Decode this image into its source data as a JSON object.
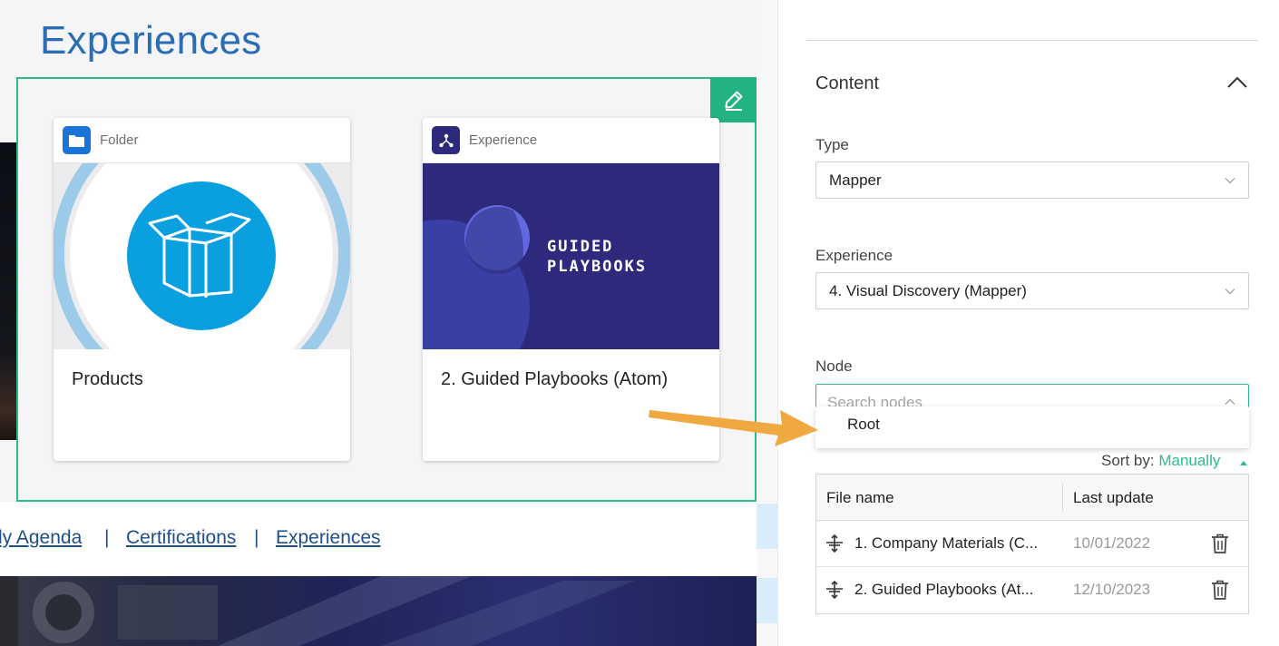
{
  "page": {
    "title": "Experiences"
  },
  "cards": [
    {
      "type_label": "Folder",
      "title": "Products"
    },
    {
      "type_label": "Experience",
      "title": "2. Guided Playbooks (Atom)",
      "image_text_line1": "GUIDED",
      "image_text_line2": "PLAYBOOKS"
    }
  ],
  "footer_links": {
    "link1": "ly Agenda",
    "separator": "|",
    "link2": "Certifications",
    "link3": "Experiences"
  },
  "panel": {
    "section_title": "Content",
    "type": {
      "label": "Type",
      "value": "Mapper"
    },
    "experience": {
      "label": "Experience",
      "value": "4. Visual Discovery (Mapper)"
    },
    "node": {
      "label": "Node",
      "placeholder": "Search nodes",
      "options": [
        "Root"
      ]
    },
    "sort": {
      "label": "Sort by:",
      "value": "Manually"
    },
    "table": {
      "headers": {
        "file_name": "File name",
        "last_update": "Last update"
      },
      "rows": [
        {
          "name": "1. Company Materials (C...",
          "date": "10/01/2022"
        },
        {
          "name": "2. Guided Playbooks (At...",
          "date": "12/10/2023"
        }
      ]
    }
  },
  "colors": {
    "accent_green": "#2dbb8a",
    "title_blue": "#2a6db5",
    "link_blue": "#1f4f8a",
    "folder_badge": "#1a73d6",
    "experience_badge": "#2d2a7e",
    "annotation_arrow": "#f0a840"
  },
  "icons": {
    "edit": "pencil-icon",
    "folder": "folder-icon",
    "experience": "network-icon",
    "collapse": "chevron-up-icon",
    "select": "chevron-down-icon",
    "drag": "drag-handle-icon",
    "delete": "trash-icon"
  }
}
